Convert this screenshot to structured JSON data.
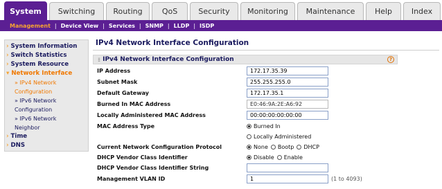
{
  "tabs": [
    {
      "label": "System",
      "active": true
    },
    {
      "label": "Switching",
      "active": false
    },
    {
      "label": "Routing",
      "active": false
    },
    {
      "label": "QoS",
      "active": false
    },
    {
      "label": "Security",
      "active": false
    },
    {
      "label": "Monitoring",
      "active": false
    },
    {
      "label": "Maintenance",
      "active": false
    },
    {
      "label": "Help",
      "active": false
    },
    {
      "label": "Index",
      "active": false
    }
  ],
  "subnav": [
    "Management",
    "Device View",
    "Services",
    "SNMP",
    "LLDP",
    "ISDP"
  ],
  "sidebar": {
    "items": [
      "System Information",
      "Switch Statistics",
      "System Resource",
      "Network Interface",
      "Time",
      "DNS"
    ],
    "network_sub": [
      "» IPv4 Network",
      "Configuration",
      "» IPv6 Network",
      "Configuration",
      "» IPv6 Network",
      "Neighbor"
    ]
  },
  "page": {
    "title": "IPv4 Network Interface Configuration",
    "section_title": "IPv4 Network Interface Configuration",
    "help_icon": "?"
  },
  "fields": {
    "ip_address": {
      "label": "IP Address",
      "value": "172.17.35.39"
    },
    "subnet_mask": {
      "label": "Subnet Mask",
      "value": "255.255.255.0"
    },
    "default_gateway": {
      "label": "Default Gateway",
      "value": "172.17.35.1"
    },
    "burned_mac": {
      "label": "Burned In MAC Address",
      "value": "E0:46:9A:2E:A6:92"
    },
    "local_mac": {
      "label": "Locally Administered MAC Address",
      "value": "00:00:00:00:00:00"
    },
    "mac_type": {
      "label": "MAC Address Type",
      "options": [
        "Burned In",
        "Locally Administered"
      ]
    },
    "protocol": {
      "label": "Current Network Configuration Protocol",
      "options": [
        "None",
        "Bootp",
        "DHCP"
      ]
    },
    "dhcp_vendor_id": {
      "label": "DHCP Vendor Class Identifier",
      "options": [
        "Disable",
        "Enable"
      ]
    },
    "dhcp_vendor_string": {
      "label": "DHCP Vendor Class Identifier String",
      "value": ""
    },
    "mgmt_vlan": {
      "label": "Management VLAN ID",
      "value": "1",
      "hint": "(1 to 4093)"
    }
  },
  "colors": {
    "brand": "#5b1f93",
    "accent": "#f7a331"
  }
}
